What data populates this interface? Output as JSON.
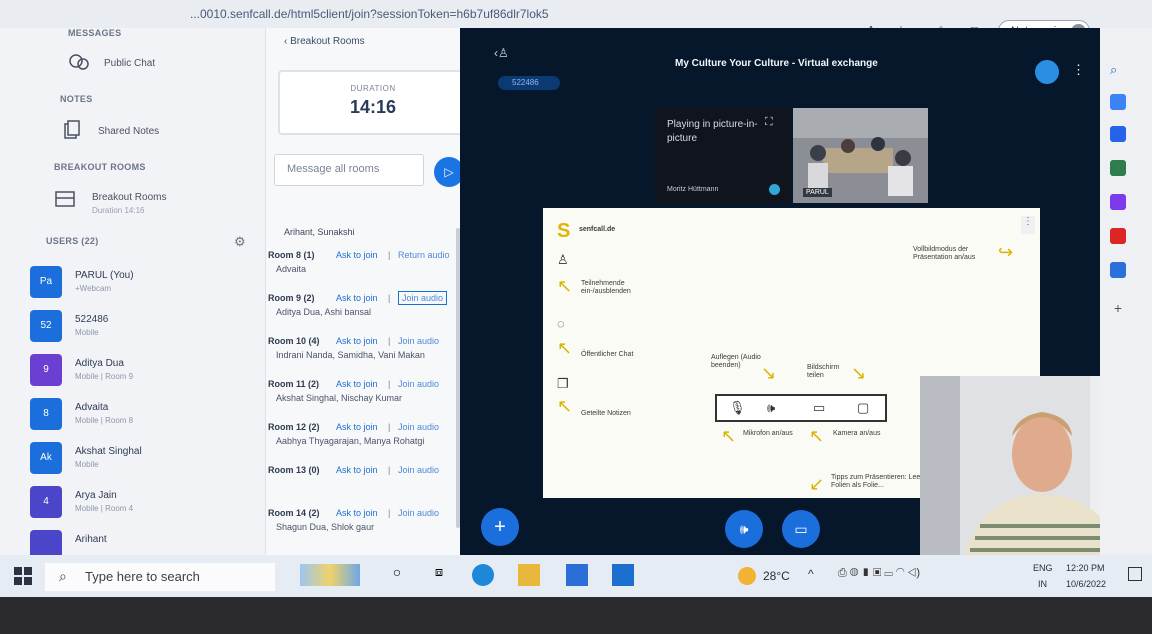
{
  "browser": {
    "url": "...0010.senfcall.de/html5client/join?sessionToken=h6b7uf86dlr7lok5",
    "sync_label": "Not syncing"
  },
  "sidebar": {
    "messages_title": "MESSAGES",
    "public_chat": "Public Chat",
    "notes_title": "NOTES",
    "shared_notes": "Shared Notes",
    "breakout_title": "BREAKOUT ROOMS",
    "breakout_item": "Breakout Rooms",
    "breakout_sub": "Duration 14:16",
    "users_title": "USERS (22)",
    "users": [
      {
        "initials": "Pa",
        "name": "PARUL (You)",
        "sub": "+Webcam",
        "color": "#1a6fdc"
      },
      {
        "initials": "52",
        "name": "522486",
        "sub": "Mobile",
        "color": "#1a6fdc"
      },
      {
        "initials": "9",
        "name": "Aditya Dua",
        "sub": "Mobile | Room 9",
        "color": "#6b3fd1"
      },
      {
        "initials": "8",
        "name": "Advaita",
        "sub": "Mobile | Room 8",
        "color": "#1a6fdc"
      },
      {
        "initials": "Ak",
        "name": "Akshat Singhal",
        "sub": "Mobile",
        "color": "#1a6fdc"
      },
      {
        "initials": "4",
        "name": "Arya Jain",
        "sub": "Mobile | Room 4",
        "color": "#4a45c9"
      },
      {
        "initials": "",
        "name": "Arihant",
        "sub": "",
        "color": "#4a45c9"
      }
    ]
  },
  "breakout": {
    "back_label": "Breakout Rooms",
    "duration_label": "DURATION",
    "duration_time": "14:16",
    "message_placeholder": "Message all rooms",
    "top_names": "Arihant, Sunakshi",
    "rooms": [
      {
        "title": "Room 8 (1)",
        "ask": "Ask to join",
        "join": "Return audio",
        "people": "Advaita",
        "boxed": false
      },
      {
        "title": "Room 9 (2)",
        "ask": "Ask to join",
        "join": "Join audio",
        "people": "Aditya Dua, Ashi bansal",
        "boxed": true
      },
      {
        "title": "Room 10 (4)",
        "ask": "Ask to join",
        "join": "Join audio",
        "people": "Indrani Nanda, Samidha, Vani Makan",
        "boxed": false
      },
      {
        "title": "Room 11 (2)",
        "ask": "Ask to join",
        "join": "Join audio",
        "people": "Akshat Singhal, Nischay Kumar",
        "boxed": false
      },
      {
        "title": "Room 12 (2)",
        "ask": "Ask to join",
        "join": "Join audio",
        "people": "Aabhya Thyagarajan, Manya Rohatgi",
        "boxed": false
      },
      {
        "title": "Room 13 (0)",
        "ask": "Ask to join",
        "join": "Join audio",
        "people": "",
        "boxed": false
      },
      {
        "title": "Room 14 (2)",
        "ask": "Ask to join",
        "join": "Join audio",
        "people": "Shagun Dua, Shlok gaur",
        "boxed": false
      }
    ]
  },
  "main": {
    "meeting_title": "My Culture Your Culture - Virtual exchange",
    "user_badge": "522486",
    "pip_text": "Playing in picture-in-picture",
    "pip_name": "Moritz Hüttmann",
    "parul_tag": "PARUL"
  },
  "slide": {
    "brand": "senfcall.de",
    "fullscreen_hint": "Vollbildmodus der Präsentation an/aus",
    "participants_hint": "Teilnehmende ein-/ausblenden",
    "public_chat": "Öffentlicher Chat",
    "shared_notes": "Geteilte Notizen",
    "hangup": "Auflegen (Audio beenden)",
    "screen_share": "Bildschirm teilen",
    "mic": "Mikrofon an/aus",
    "camera": "Kamera an/aus",
    "tips": "Tipps zum Präsentieren: Leere Folien als Folie..."
  },
  "taskbar": {
    "search_placeholder": "Type here to search",
    "temperature": "28°C",
    "lang1": "ENG",
    "lang2": "IN",
    "time": "12:20 PM",
    "date": "10/6/2022"
  }
}
